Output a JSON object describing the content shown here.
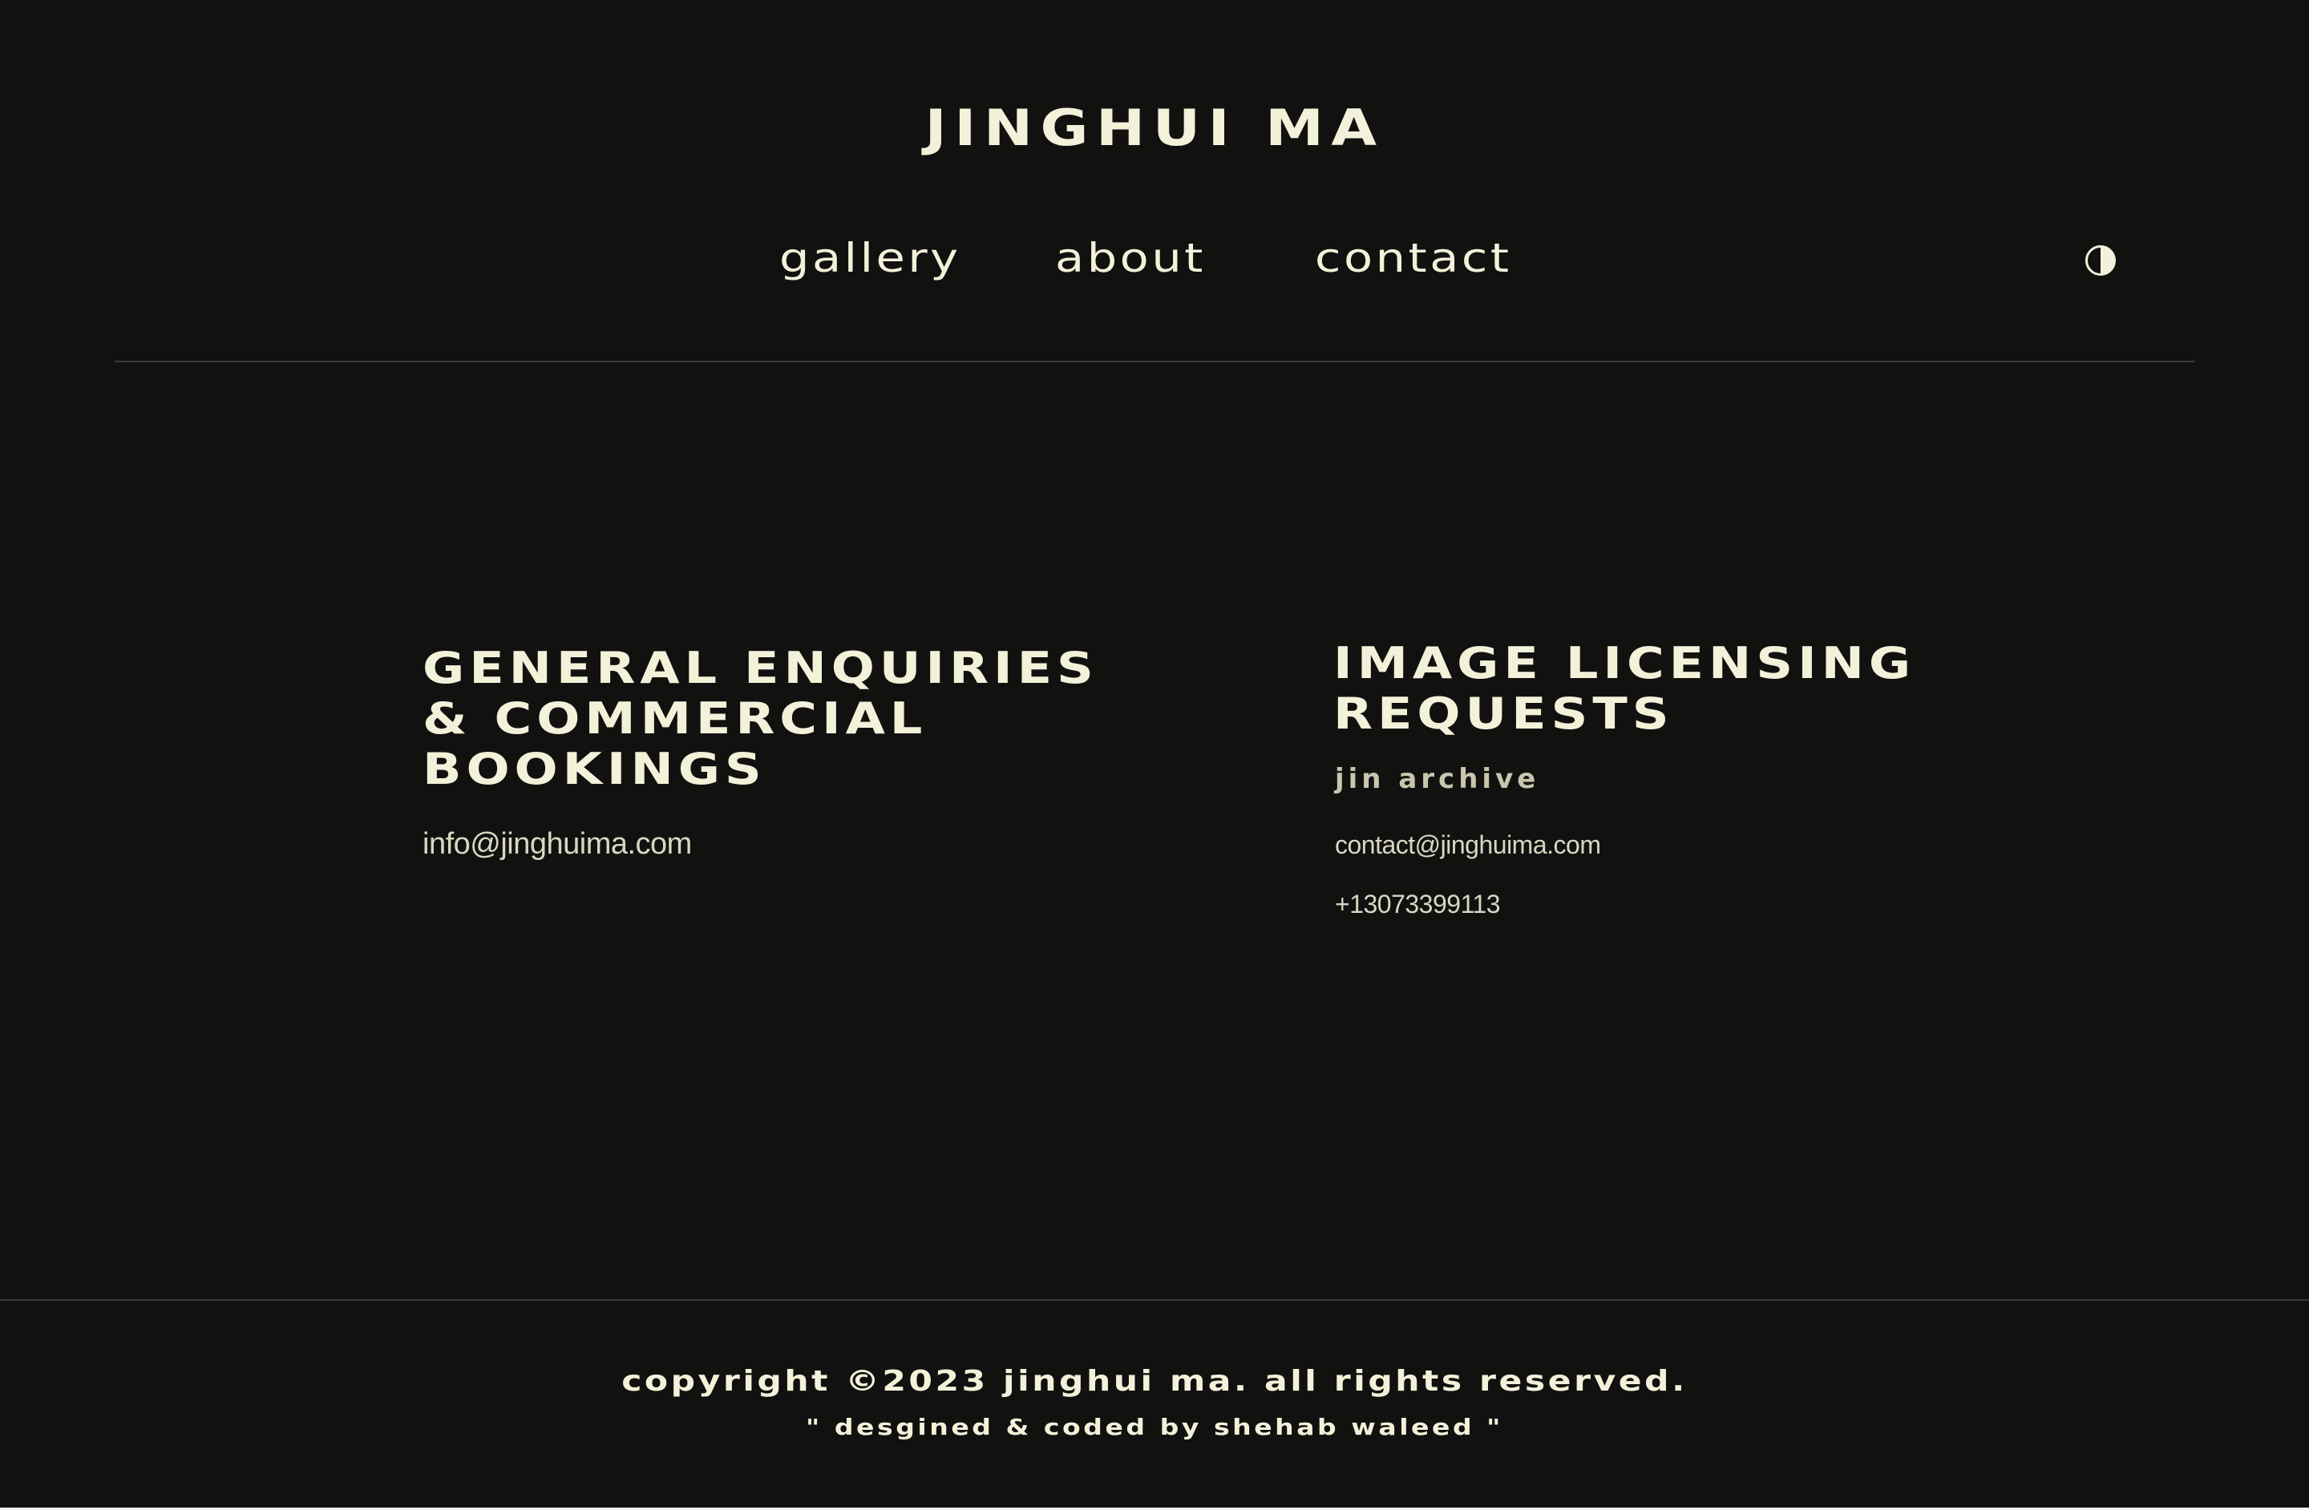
{
  "header": {
    "site_title": "JINGHUI MA",
    "nav": {
      "gallery": "gallery",
      "about": "about",
      "contact": "contact"
    },
    "theme_toggle_icon": "contrast-half-circle-icon"
  },
  "main": {
    "general": {
      "heading": "GENERAL ENQUIRIES & COMMERCIAL BOOKINGS",
      "email": "info@jinghuima.com"
    },
    "licensing": {
      "heading": "IMAGE LICENSING REQUESTS",
      "archive_label": "jin archive",
      "email": "contact@jinghuima.com",
      "phone": "+13073399113"
    }
  },
  "footer": {
    "copyright": "copyright ©2023 jinghui ma. all rights reserved.",
    "credit": "\" desgined & coded by shehab waleed \""
  },
  "colors": {
    "background": "#111210",
    "text": "#f4f1da",
    "muted_text": "#d9d6c2",
    "divider": "#3a3b37"
  }
}
